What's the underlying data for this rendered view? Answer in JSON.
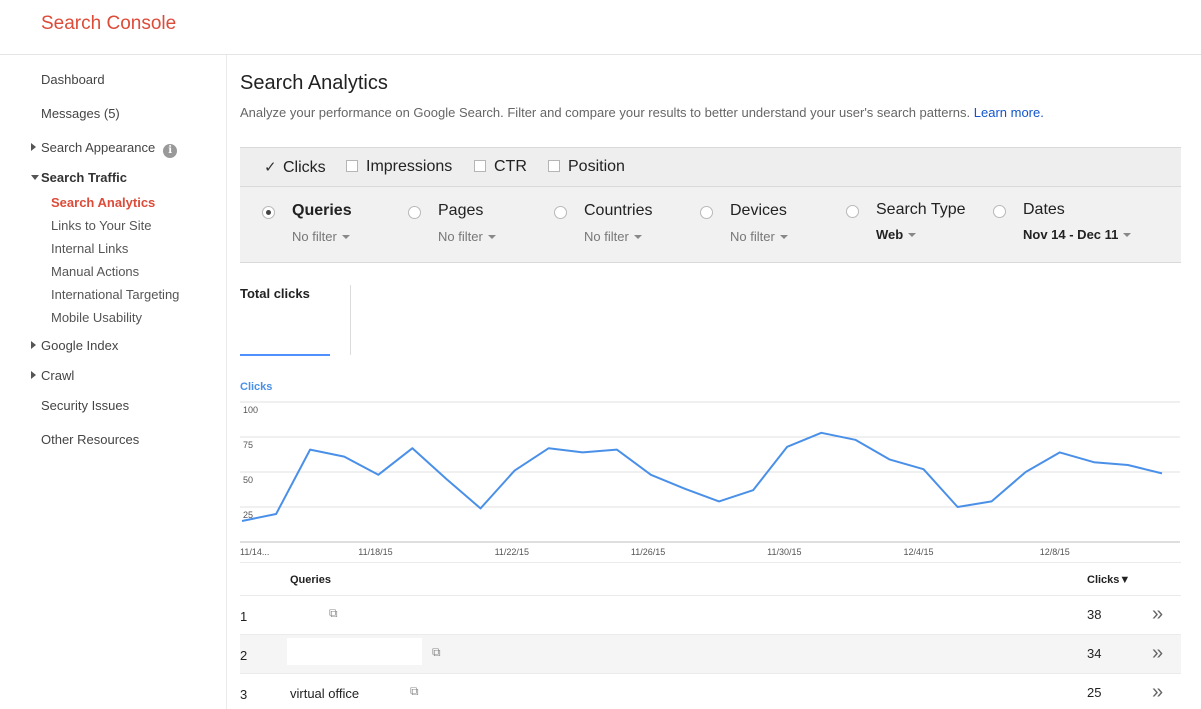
{
  "app": {
    "brand": "Search Console"
  },
  "sidebar": {
    "dashboard": "Dashboard",
    "messages": "Messages (5)",
    "search_appearance": "Search Appearance",
    "search_traffic": "Search Traffic",
    "sub_items": [
      "Search Analytics",
      "Links to Your Site",
      "Internal Links",
      "Manual Actions",
      "International Targeting",
      "Mobile Usability"
    ],
    "google_index": "Google Index",
    "crawl": "Crawl",
    "security_issues": "Security Issues",
    "other_resources": "Other Resources",
    "info_icon": "info-icon"
  },
  "page": {
    "title": "Search Analytics",
    "description": "Analyze your performance on Google Search. Filter and compare your results to better understand your user's search patterns.",
    "learn_more": "Learn more."
  },
  "metrics": [
    {
      "label": "Clicks",
      "checked": true
    },
    {
      "label": "Impressions",
      "checked": false
    },
    {
      "label": "CTR",
      "checked": false
    },
    {
      "label": "Position",
      "checked": false
    }
  ],
  "groupings": [
    {
      "label": "Queries",
      "filter": "No filter",
      "selected": true
    },
    {
      "label": "Pages",
      "filter": "No filter",
      "selected": false
    },
    {
      "label": "Countries",
      "filter": "No filter",
      "selected": false
    },
    {
      "label": "Devices",
      "filter": "No filter",
      "selected": false
    },
    {
      "label": "Search Type",
      "filter": "Web",
      "selected": false
    },
    {
      "label": "Dates",
      "filter": "Nov 14 - Dec 11",
      "selected": false
    }
  ],
  "summary": {
    "total_clicks_label": "Total clicks"
  },
  "chart_data": {
    "type": "line",
    "ylabel": "Clicks",
    "ylim": [
      0,
      100
    ],
    "yticks": [
      25,
      50,
      75,
      100
    ],
    "x": [
      "11/14",
      "11/15",
      "11/16",
      "11/17",
      "11/18",
      "11/19",
      "11/20",
      "11/21",
      "11/22",
      "11/23",
      "11/24",
      "11/25",
      "11/26",
      "11/27",
      "11/28",
      "11/29",
      "11/30",
      "12/1",
      "12/2",
      "12/3",
      "12/4",
      "12/5",
      "12/6",
      "12/7",
      "12/8",
      "12/9",
      "12/10",
      "12/11"
    ],
    "xtick_labels": [
      "11/14...",
      "11/18/15",
      "11/22/15",
      "11/26/15",
      "11/30/15",
      "12/4/15",
      "12/8/15"
    ],
    "series": [
      {
        "values": [
          15,
          20,
          66,
          61,
          48,
          67,
          45,
          24,
          51,
          67,
          64,
          66,
          48,
          38,
          29,
          37,
          68,
          78,
          73,
          59,
          52,
          25,
          29,
          50,
          64,
          57,
          55,
          49
        ]
      }
    ],
    "color": "#4a90e8",
    "grid": true
  },
  "table": {
    "headers": {
      "query": "Queries",
      "clicks": "Clicks▼"
    },
    "rows": [
      {
        "rank": "1",
        "query": "",
        "clicks": "38"
      },
      {
        "rank": "2",
        "query": "",
        "clicks": "34"
      },
      {
        "rank": "3",
        "query": "virtual office",
        "clicks": "25"
      }
    ]
  },
  "icons": {
    "external": "external-link-icon",
    "expand": "double-chevron-icon"
  }
}
